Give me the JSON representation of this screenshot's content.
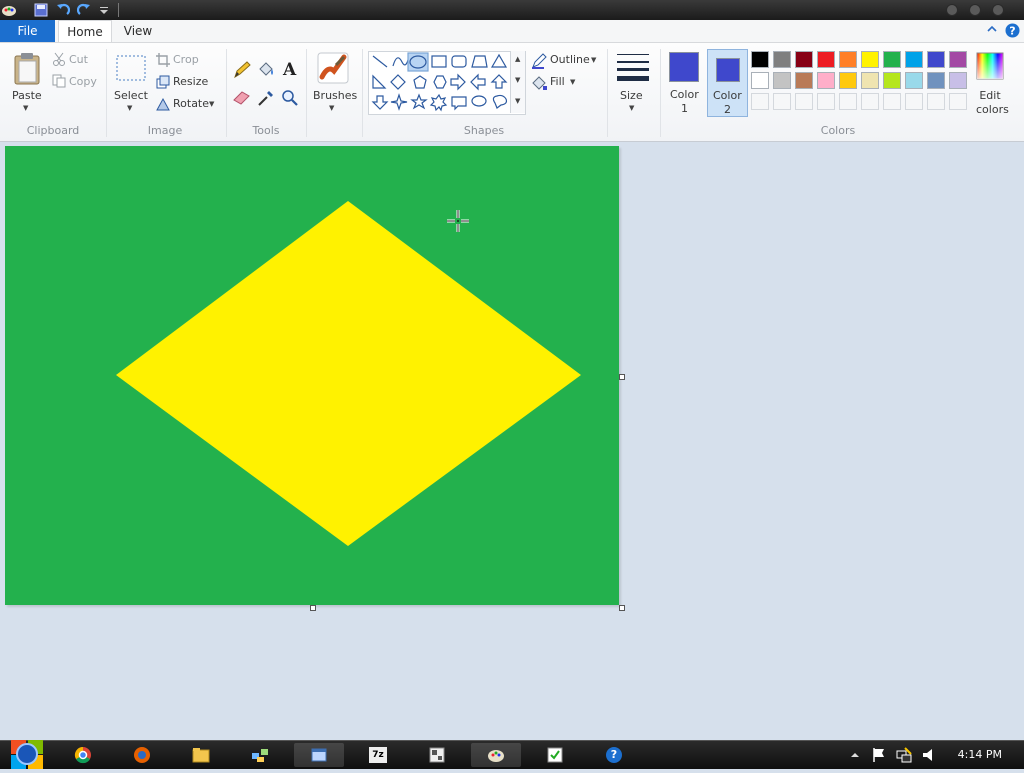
{
  "window": {
    "quick_access": [
      "save-icon",
      "undo-icon",
      "redo-icon",
      "customize-icon"
    ]
  },
  "tabs": {
    "file": "File",
    "home": "Home",
    "view": "View"
  },
  "clipboard": {
    "paste": "Paste",
    "cut": "Cut",
    "copy": "Copy",
    "group": "Clipboard"
  },
  "image": {
    "select": "Select",
    "crop": "Crop",
    "resize": "Resize",
    "rotate": "Rotate",
    "group": "Image"
  },
  "tools": {
    "group": "Tools"
  },
  "brushes": {
    "label": "Brushes"
  },
  "shapes": {
    "outline": "Outline",
    "fill": "Fill",
    "group": "Shapes"
  },
  "size": {
    "label": "Size"
  },
  "colors": {
    "color1_label": "Color",
    "color1_num": "1",
    "color1_value": "#3f48cc",
    "color2_label": "Color",
    "color2_num": "2",
    "color2_value": "#3f48cc",
    "edit": "Edit colors",
    "group": "Colors",
    "palette_row1": [
      "#000000",
      "#7f7f7f",
      "#880015",
      "#ed1c24",
      "#ff7f27",
      "#fff200",
      "#22b14c",
      "#00a2e8",
      "#3f48cc",
      "#a349a4"
    ],
    "palette_row2": [
      "#ffffff",
      "#c3c3c3",
      "#b97a57",
      "#ffaec9",
      "#ffc90e",
      "#efe4b0",
      "#b5e61d",
      "#99d9ea",
      "#7092be",
      "#c8bfe7"
    ]
  },
  "canvas": {
    "background": "#23b14d",
    "diamond": "#fff200"
  },
  "taskbar": {
    "apps": [
      "chrome-icon",
      "firefox-icon",
      "explorer-icon",
      "network-icon",
      "window-icon",
      "sevenzip-icon",
      "control-icon",
      "paint-icon",
      "tasks-icon",
      "help-icon"
    ],
    "sevenzip_text": "7z",
    "help_text": "?",
    "time": "4:14 PM"
  }
}
